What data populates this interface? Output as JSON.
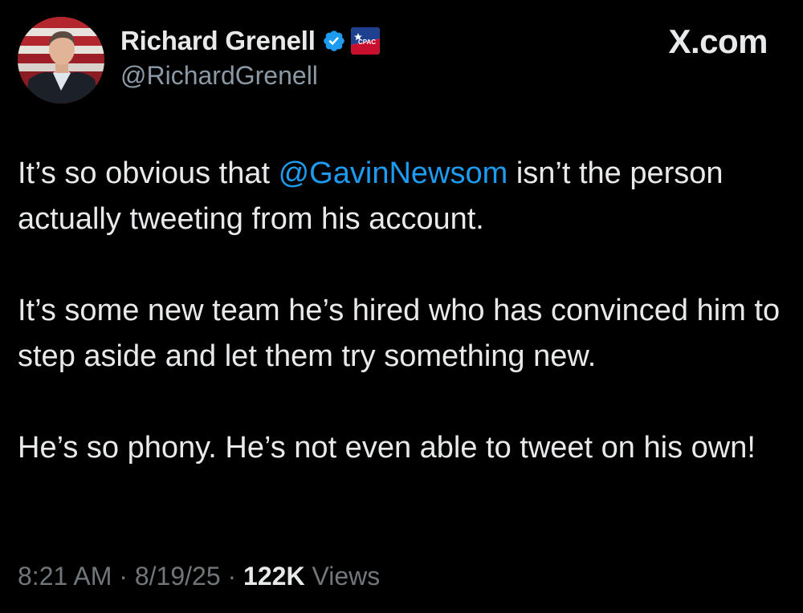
{
  "author": {
    "display_name": "Richard Grenell",
    "handle": "@RichardGrenell",
    "verified_icon": "verified-badge-icon",
    "affiliation_badge_text": "CPAC"
  },
  "brand": {
    "label": "X.com"
  },
  "tweet": {
    "paragraph1_before": "It’s so obvious that ",
    "mention": "@GavinNewsom",
    "paragraph1_after": " isn’t the person actually tweeting from his account.",
    "paragraph2": "It’s some new team he’s hired who has convinced him to step aside and let them try something new.",
    "paragraph3": "He’s so phony. He’s not even able to tweet on his own!"
  },
  "meta": {
    "time": "8:21 AM",
    "separator": " · ",
    "date": "8/19/25",
    "views_count": "122K",
    "views_label": " Views"
  },
  "colors": {
    "background": "#000000",
    "text": "#e7e9ea",
    "secondary": "#71767b",
    "mention": "#1d9bf0",
    "verified": "#1d9bf0"
  }
}
